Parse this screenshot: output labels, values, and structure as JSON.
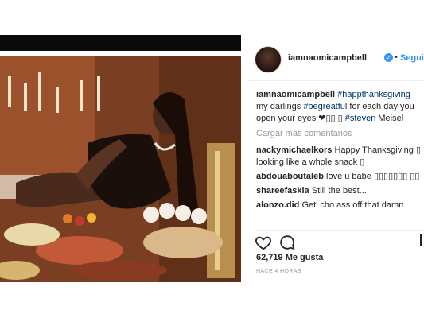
{
  "post": {
    "username": "iamnaomicampbell",
    "verified_symbol": "✓",
    "separator": "•",
    "follow_label": "Seguir",
    "caption": {
      "username": "iamnaomicampbell",
      "hashtag1": "#happthanksgiving",
      "text1": "my darlings",
      "hashtag2": "#begreatful",
      "text2": "for each day you open your eyes ❤▯▯ ▯",
      "hashtag3": "#steven",
      "text3": "Meisel"
    },
    "load_more_label": "Cargar más comentarios",
    "comments": [
      {
        "username": "nackymichaelkors",
        "text": "Happy Thanksgiving ▯ looking like a whole snack ▯"
      },
      {
        "username": "abdouaboutaleb",
        "text": "love u babe ▯▯▯▯▯▯▯ ▯▯"
      },
      {
        "username": "shareefaskia",
        "text": "Still the best..."
      },
      {
        "username": "alonzo.did",
        "text": "Get' cho ass off that damn"
      }
    ],
    "likes": "62,719 Me gusta",
    "timestamp": "HACE 4 HORAS"
  },
  "icons": {
    "heart": "heart-icon",
    "comment": "comment-icon",
    "bookmark": "bookmark-icon",
    "verified": "verified-badge-icon"
  },
  "colors": {
    "link_blue": "#3897f0",
    "hashtag": "#003569",
    "muted": "#999999",
    "text": "#262626"
  }
}
